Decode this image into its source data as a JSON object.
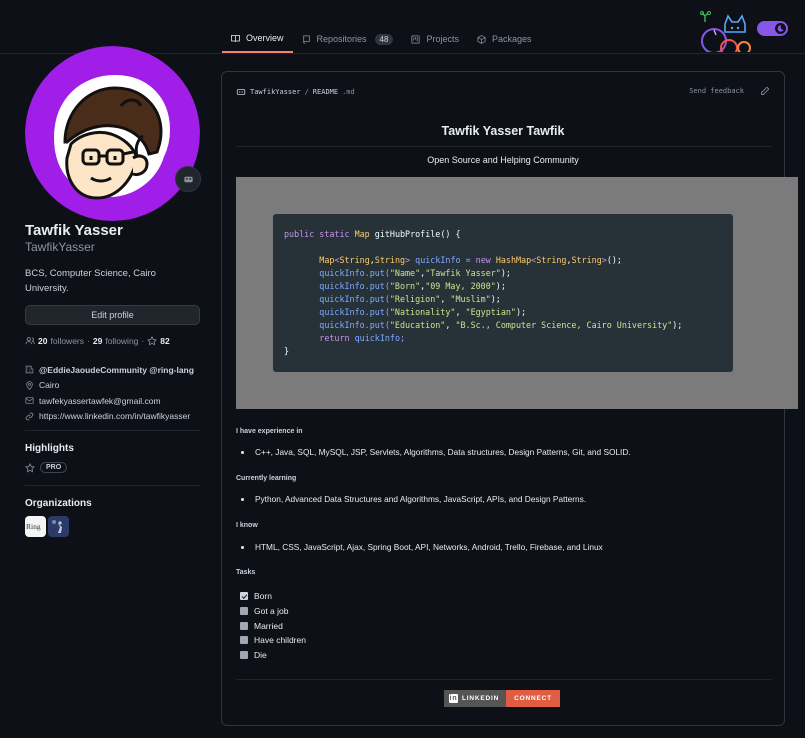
{
  "tabs": [
    {
      "label": "Overview",
      "icon": "book-icon",
      "active": true
    },
    {
      "label": "Repositories",
      "icon": "repo-icon",
      "count": "48"
    },
    {
      "label": "Projects",
      "icon": "project-icon"
    },
    {
      "label": "Packages",
      "icon": "package-icon"
    }
  ],
  "profile": {
    "name": "Tawfik Yasser",
    "login": "TawfikYasser",
    "bio": "BCS, Computer Science, Cairo University.",
    "edit_label": "Edit profile",
    "followers_count": "20",
    "followers_label": "followers",
    "sep1": "·",
    "following_count": "29",
    "following_label": "following",
    "sep2": "·",
    "stars": "82",
    "company": "@EddieJaoudeCommunity @ring-lang",
    "location": "Cairo",
    "email": "tawfekyassertawfek@gmail.com",
    "website": "https://www.linkedin.com/in/tawfikyasser"
  },
  "sidebar": {
    "highlights_title": "Highlights",
    "pro_label": "PRO",
    "organizations_title": "Organizations",
    "org1_label": "Ring"
  },
  "readme": {
    "path_user": "TawfikYasser",
    "path_sep": "/",
    "path_file": "README",
    "path_ext": ".md",
    "feedback": "Send feedback",
    "title": "Tawfik Yasser Tawfik",
    "subtitle": "Open Source and Helping Community",
    "code": {
      "l1": {
        "a": "public static ",
        "b": "Map",
        "c": " gitHubProfile() {"
      },
      "l2": {
        "a": "Map",
        "b": "<",
        "c": "String",
        "d": ",",
        "e": "String",
        "f": ">",
        "g": " quickInfo = ",
        "h": "new ",
        "i": "HashMap",
        "j": "<",
        "k": "String",
        "l": ",",
        "m": "String",
        "n": ">",
        "o": "();"
      },
      "puts": [
        {
          "k": "\"Name\"",
          "v": "\"Tawfik Yasser\""
        },
        {
          "k": "\"Born\"",
          "v": "\"09 May, 2000\""
        },
        {
          "k": "\"Religion\"",
          "v": " \"Muslim\""
        },
        {
          "k": "\"Nationality\"",
          "v": " \"Egyptian\""
        },
        {
          "k": "\"Education\"",
          "v": " \"B.Sc., Computer Science, Cairo University\""
        }
      ],
      "put_prefix": "quickInfo.put(",
      "put_mid": ",",
      "put_end": ");",
      "ret_kw": "return",
      "ret_rest": " quickInfo;",
      "close": "}"
    },
    "sections": {
      "experience_title": "I have experience in",
      "experience_item": "C++, Java, SQL, MySQL, JSP, Servlets, Algorithms, Data structures, Design Patterns, Git, and SOLID.",
      "learning_title": "Currently learning",
      "learning_item": "Python, Advanced Data Structures and Algorithms, JavaScript, APIs, and Design Patterns.",
      "know_title": "I know",
      "know_item": "HTML, CSS, JavaScript, Ajax, Spring Boot, API, Networks, Android, Trello, Firebase, and Linux",
      "tasks_title": "Tasks"
    },
    "tasks": [
      {
        "label": "Born",
        "checked": true
      },
      {
        "label": "Got a job",
        "checked": false
      },
      {
        "label": "Married",
        "checked": false
      },
      {
        "label": "Have children",
        "checked": false
      },
      {
        "label": "Die",
        "checked": false
      }
    ],
    "badge": {
      "left": "LINKEDIN",
      "right": "CONNECT",
      "left_color": "#555555",
      "right_color": "#e05d44"
    }
  },
  "colors": {
    "accent": "#f78166",
    "avatar_ring": "#a020f0",
    "toggle": "#8957e5"
  }
}
